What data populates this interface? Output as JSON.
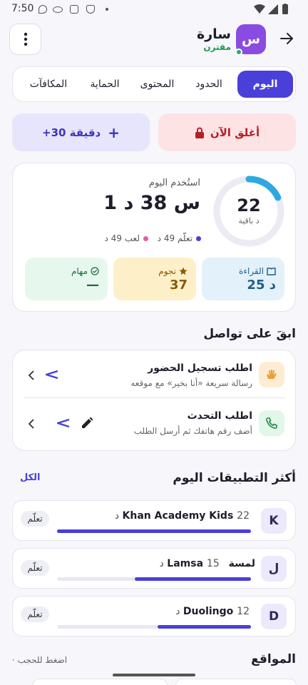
{
  "status": {
    "time": "7:50"
  },
  "header": {
    "profile_name": "سارة",
    "profile_status": "مقترن",
    "avatar_letter": "س"
  },
  "tabs": [
    {
      "label": "اليوم"
    },
    {
      "label": "الحدود"
    },
    {
      "label": "المحتوى"
    },
    {
      "label": "الحماية"
    },
    {
      "label": "المكافآت"
    }
  ],
  "actions": {
    "lock_now": "أغلق الآن",
    "add_time": "+30 دقيقة"
  },
  "usage": {
    "used_label": "استُخدم اليوم",
    "used_value": "1 س 38 د",
    "remaining_value": "22",
    "remaining_label": "د باقية",
    "remaining_fraction": 0.18,
    "learn_legend": "تعلّم 49 د",
    "play_legend": "لعب 49 د",
    "stats": [
      {
        "title": "القراءة",
        "value": "25 د"
      },
      {
        "title": "نجوم",
        "value": "37"
      },
      {
        "title": "مهام",
        "value": "—"
      }
    ]
  },
  "connect": {
    "title": "ابقَ على تواصل",
    "checkin": {
      "title": "اطلب تسجيل الحضور",
      "subtitle": "رسالة سريعة «أنا بخير» مع موقعه"
    },
    "call": {
      "title": "اطلب التحدث",
      "subtitle": "أضف رقم هاتفك ثم أرسل الطلب"
    }
  },
  "top_apps": {
    "title": "أكثر التطبيقات اليوم",
    "see_all": "الكل",
    "apps": [
      {
        "letter": "K",
        "name": "Khan Academy Kids",
        "time": "22 د",
        "category": "تعلّم",
        "fraction": 1.0
      },
      {
        "letter": "ل",
        "name": "لمسة Lamsa",
        "time": "15 د",
        "category": "تعلّم",
        "fraction": 0.6
      },
      {
        "letter": "D",
        "name": "Duolingo",
        "time": "12 د",
        "category": "تعلّم",
        "fraction": 0.48
      }
    ]
  },
  "sites": {
    "title": "المواقع",
    "hint": "· اضغط للحجب"
  },
  "colors": {
    "accent": "#4a3fd9",
    "lock_bg": "#fde3e3",
    "add_bg": "#e6e5fb",
    "reading_bg": "#e3f1fb",
    "stars_bg": "#fdf0c8",
    "tasks_bg": "#e6f8ee"
  }
}
